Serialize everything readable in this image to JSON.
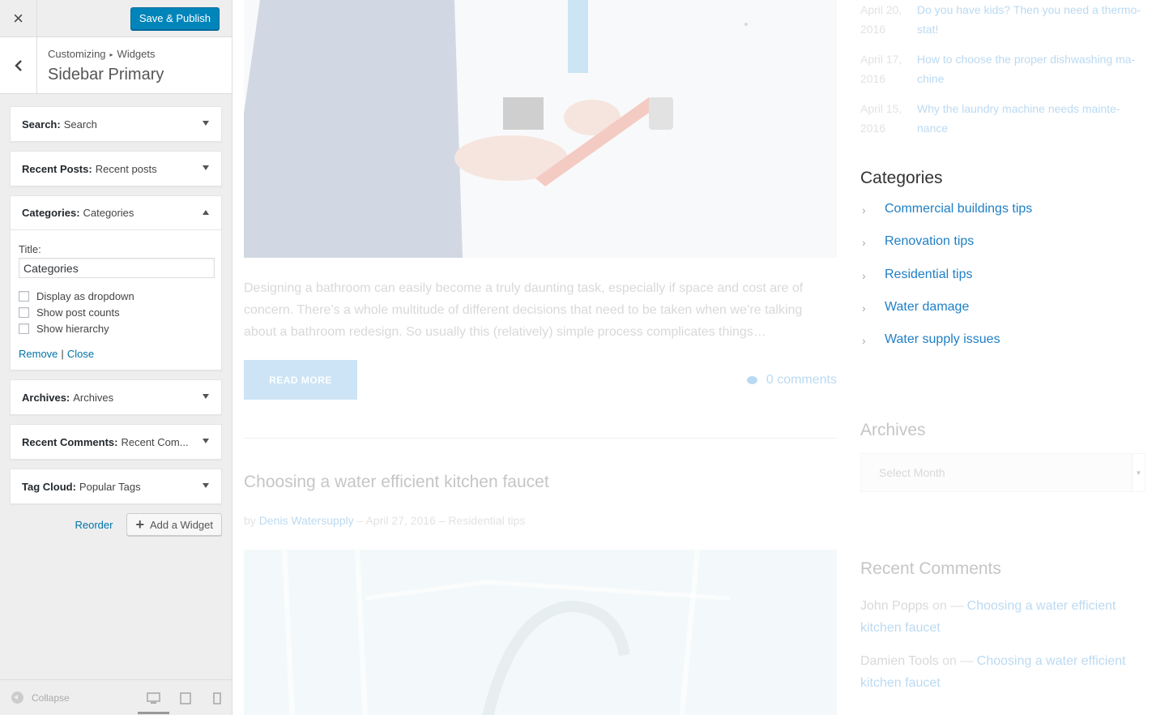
{
  "customizer": {
    "close_icon": "×",
    "publish_label": "Save & Publish",
    "breadcrumb_root": "Customizing",
    "breadcrumb_sep": "▸",
    "breadcrumb_child": "Widgets",
    "section_title": "Sidebar Primary",
    "widgets": [
      {
        "type": "Search:",
        "name": "Search"
      },
      {
        "type": "Recent Posts:",
        "name": "Recent posts"
      },
      {
        "type": "Categories:",
        "name": "Categories"
      },
      {
        "type": "Archives:",
        "name": "Archives"
      },
      {
        "type": "Recent Comments:",
        "name": "Recent Com..."
      },
      {
        "type": "Tag Cloud:",
        "name": "Popular Tags"
      }
    ],
    "open_widget": {
      "title_label": "Title:",
      "title_value": "Categories",
      "opt_dropdown": "Display as dropdown",
      "opt_counts": "Show post counts",
      "opt_hierarchy": "Show hierarchy",
      "remove_label": "Remove",
      "sep": "|",
      "close_label": "Close"
    },
    "reorder_label": "Reorder",
    "add_widget_label": "Add a Widget",
    "collapse_label": "Collapse",
    "accent_color": "#0085ba"
  },
  "preview": {
    "excerpt": "Designing a bathroom can easily become a truly daunting task, especially if space and cost are of concern. There’s a whole multitude of different decisions that need to be taken when we’re talking about a bathroom redesign. So usually this (relatively) simple process complicates things…",
    "read_more": "READ MORE",
    "comments": "0 comments",
    "post_title": "Choosing a water efficient kitchen faucet",
    "meta_by": "by",
    "meta_author": "Denis Watersupply",
    "meta_rest": "– April 27, 2016 – Residential tips",
    "recent_posts": [
      {
        "date_line1": "April 20,",
        "date_line2": "2016",
        "line1": "Do you have kids? Then you need a thermo-",
        "line2": "stat!"
      },
      {
        "date_line1": "April 17,",
        "date_line2": "2016",
        "line1": "How to choose the proper dishwashing ma-",
        "line2": "chine"
      },
      {
        "date_line1": "April 15,",
        "date_line2": "2016",
        "line1": "Why the laundry machine needs mainte-",
        "line2": "nance"
      }
    ],
    "categories_heading": "Categories",
    "categories": [
      "Commercial buildings tips",
      "Renovation tips",
      "Residential tips",
      "Water damage",
      "Water supply issues"
    ],
    "archives_heading": "Archives",
    "archives_select": "Select Month",
    "recent_comments_heading": "Recent Comments",
    "recent_comments": [
      {
        "author": "John Popps",
        "on": "on",
        "link_line1": "Choosing a water efficient",
        "link_line2": "kitchen faucet"
      },
      {
        "author": "Damien Tools",
        "on": "on",
        "link_line1": "Choosing a water efficient",
        "link_line2": "kitchen faucet"
      }
    ]
  }
}
